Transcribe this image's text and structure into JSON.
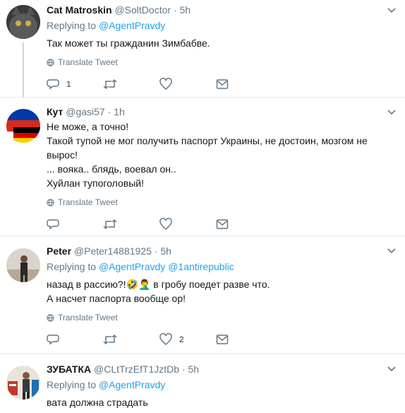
{
  "colors": {
    "link": "#1da1f2",
    "muted": "#657786",
    "border": "#e6ecf0"
  },
  "tweets": [
    {
      "name": "Cat Matroskin",
      "handle": "@SoltDoctor",
      "dot": "·",
      "time": "5h",
      "replying_label": "Replying to",
      "replying_to": [
        "@AgentPravdy"
      ],
      "lines": [
        "Так может ты гражданин Зимбабве."
      ],
      "translate": "Translate Tweet",
      "reply_count": "1",
      "retweet_count": "",
      "like_count": ""
    },
    {
      "name": "Кут",
      "handle": "@gasi57",
      "dot": "·",
      "time": "1h",
      "lines": [
        "Не може, а точно!",
        "Такой тупой не мог получить паспорт Украины, не достоин, мозгом не",
        "вырос!",
        "... вояка.. блядь, воевал он..",
        "Хуйлан тупоголовый!"
      ],
      "translate": "Translate Tweet",
      "reply_count": "",
      "retweet_count": "",
      "like_count": ""
    },
    {
      "name": "Peter",
      "handle": "@Peter14881925",
      "dot": "·",
      "time": "5h",
      "replying_label": "Replying to",
      "replying_to": [
        "@AgentPravdy",
        "@1antirepublic"
      ],
      "lines": [
        "назад в рассию?!🤣🤦‍♂️ в гробу поедет разве что.",
        "А насчет паспорта вообще ор!"
      ],
      "translate": "Translate Tweet",
      "reply_count": "",
      "retweet_count": "",
      "like_count": "2"
    },
    {
      "name": "ЗУБАТКА",
      "handle": "@CLtTrzEfT1JztDb",
      "dot": "·",
      "time": "5h",
      "replying_label": "Replying to",
      "replying_to": [
        "@AgentPravdy"
      ],
      "lines": [
        "вата должна страдать"
      ]
    }
  ]
}
